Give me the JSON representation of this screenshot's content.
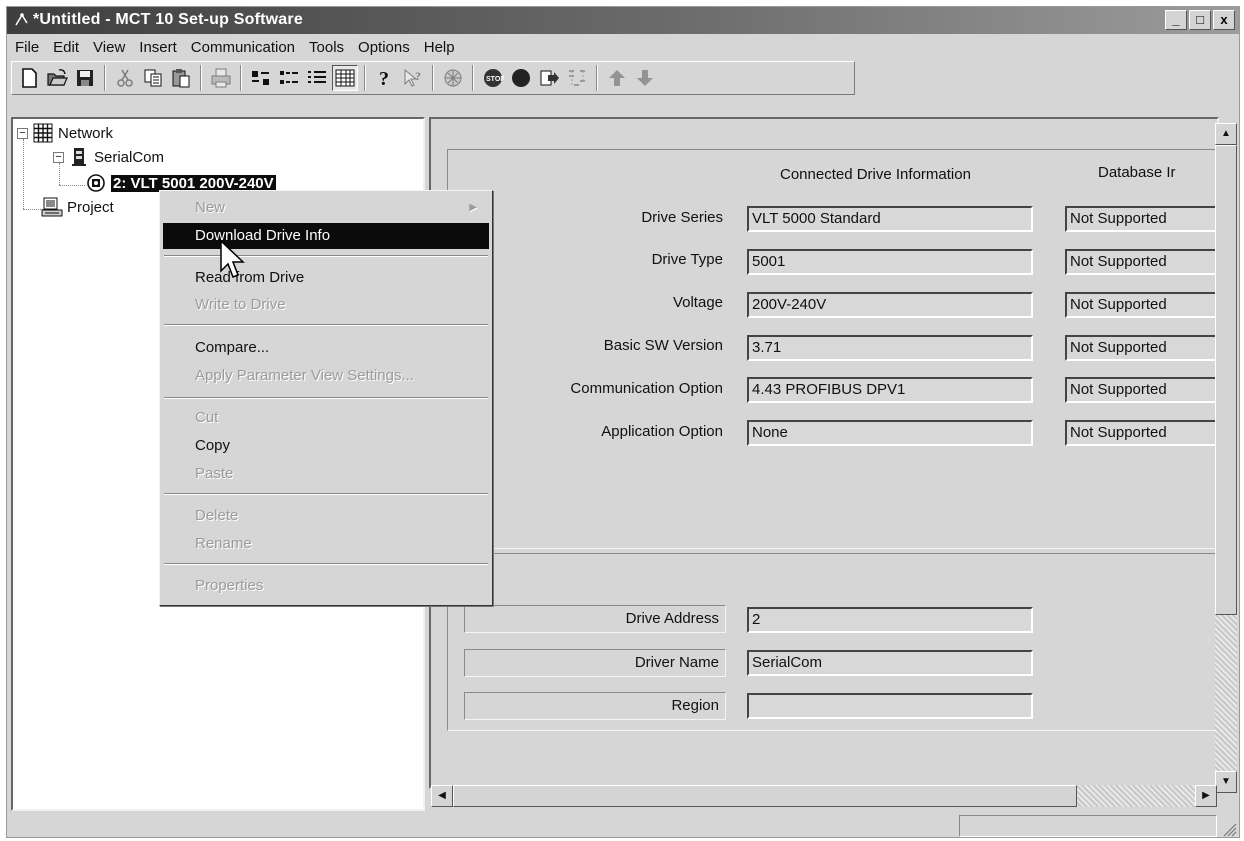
{
  "window": {
    "title": "*Untitled - MCT 10 Set-up Software",
    "controls": [
      "_",
      "□",
      "x"
    ]
  },
  "menubar": [
    "File",
    "Edit",
    "View",
    "Insert",
    "Communication",
    "Tools",
    "Options",
    "Help"
  ],
  "toolbar": {
    "groups": [
      [
        "new-icon",
        "open-icon",
        "save-icon"
      ],
      [
        "cut-icon",
        "copy-icon",
        "paste-icon"
      ],
      [
        "print-icon"
      ],
      [
        "large-icons-icon",
        "small-icons-icon",
        "list-icon",
        "details-icon"
      ],
      [
        "help-icon",
        "context-help-icon"
      ],
      [
        "network-icon"
      ],
      [
        "stop-icon",
        "record-icon",
        "download-icon",
        "scan-icon"
      ],
      [
        "arrow-up-icon",
        "arrow-down-icon"
      ]
    ],
    "pressed": "details-icon"
  },
  "tree": {
    "items": [
      {
        "label": "Network",
        "icon": "network-grid-icon",
        "expander": "−"
      },
      {
        "label": "SerialCom",
        "icon": "serial-port-icon",
        "expander": "−"
      },
      {
        "label": "2: VLT 5001 200V-240V",
        "icon": "drive-icon",
        "selected": true
      },
      {
        "label": "Project",
        "icon": "project-icon"
      }
    ]
  },
  "context_menu": {
    "items": [
      {
        "label": "New",
        "enabled": false,
        "submenu": true
      },
      {
        "label": "Download Drive Info",
        "enabled": true,
        "highlighted": true
      },
      {
        "separator": true
      },
      {
        "label": "Read from Drive",
        "enabled": true
      },
      {
        "label": "Write to Drive",
        "enabled": false
      },
      {
        "separator": true
      },
      {
        "label": "Compare...",
        "enabled": true
      },
      {
        "label": "Apply Parameter View Settings...",
        "enabled": false
      },
      {
        "separator": true
      },
      {
        "label": "Cut",
        "enabled": false
      },
      {
        "label": "Copy",
        "enabled": true
      },
      {
        "label": "Paste",
        "enabled": false
      },
      {
        "separator": true
      },
      {
        "label": "Delete",
        "enabled": false
      },
      {
        "label": "Rename",
        "enabled": false
      },
      {
        "separator": true
      },
      {
        "label": "Properties",
        "enabled": false
      }
    ]
  },
  "drive_info": {
    "col_connected": "Connected Drive Information",
    "col_database": "Database Ir",
    "rows": [
      {
        "label": "Drive Series",
        "connected": "VLT 5000 Standard",
        "database": "Not Supported"
      },
      {
        "label": "Drive Type",
        "connected": "5001",
        "database": "Not Supported"
      },
      {
        "label": "Voltage",
        "connected": "200V-240V",
        "database": "Not Supported"
      },
      {
        "label": "Basic SW Version",
        "connected": "3.71",
        "database": "Not Supported"
      },
      {
        "label": "Communication Option",
        "connected": "4.43 PROFIBUS DPV1",
        "database": "Not Supported"
      },
      {
        "label": "Application Option",
        "connected": "None",
        "database": "Not Supported"
      }
    ]
  },
  "drive_settings": [
    {
      "label": "Drive Address",
      "value": "2"
    },
    {
      "label": "Driver Name",
      "value": "SerialCom"
    },
    {
      "label": "Region",
      "value": ""
    }
  ],
  "status": {
    "text": ""
  }
}
